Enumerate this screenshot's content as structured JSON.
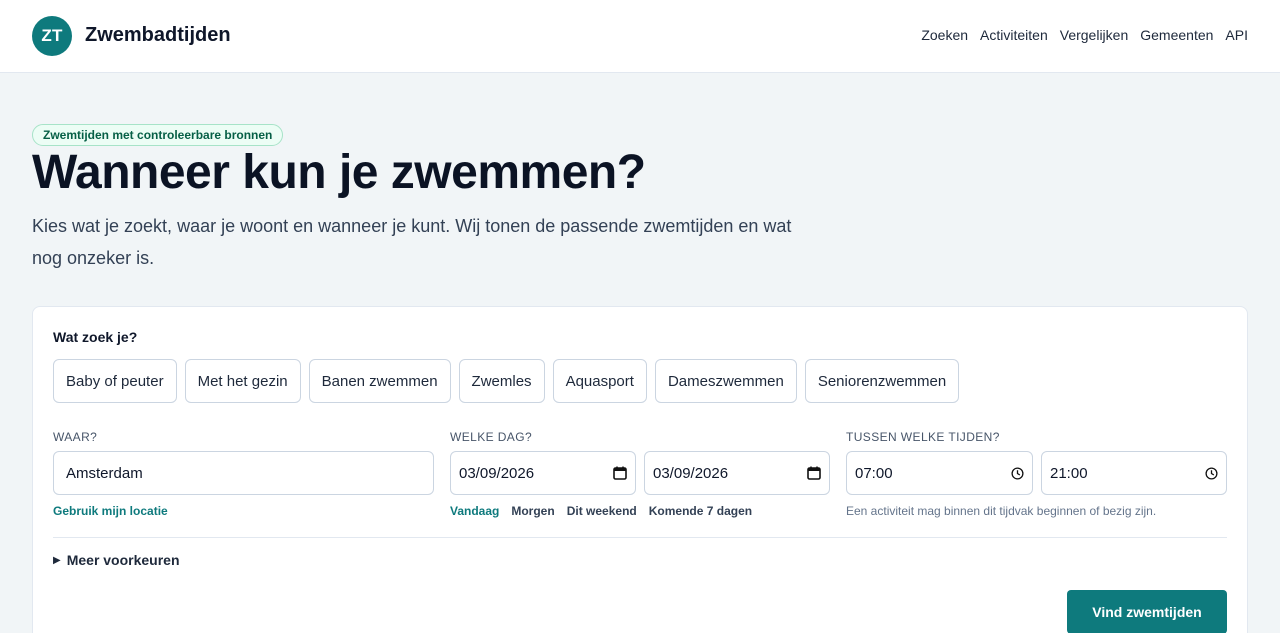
{
  "header": {
    "logo_text": "ZT",
    "brand": "Zwembadtijden",
    "nav": [
      "Zoeken",
      "Activiteiten",
      "Vergelijken",
      "Gemeenten",
      "API"
    ]
  },
  "hero": {
    "badge": "Zwemtijden met controleerbare bronnen",
    "title": "Wanneer kun je zwemmen?",
    "subtitle": "Kies wat je zoekt, waar je woont en wanneer je kunt. Wij tonen de passende zwemtijden en wat nog onzeker is."
  },
  "search": {
    "question": "Wat zoek je?",
    "activities": [
      "Baby of peuter",
      "Met het gezin",
      "Banen zwemmen",
      "Zwemles",
      "Aquasport",
      "Dameszwemmen",
      "Seniorenzwemmen"
    ],
    "where": {
      "label": "WAAR?",
      "value": "Amsterdam",
      "location_link": "Gebruik mijn locatie"
    },
    "day": {
      "label": "WELKE DAG?",
      "from": "03/09/2026",
      "to": "03/09/2026",
      "quick": [
        "Vandaag",
        "Morgen",
        "Dit weekend",
        "Komende 7 dagen"
      ],
      "active_quick": "Vandaag"
    },
    "time": {
      "label": "TUSSEN WELKE TIJDEN?",
      "from": "07:00",
      "to": "21:00",
      "hint": "Een activiteit mag binnen dit tijdvak beginnen of bezig zijn."
    },
    "more_prefs": "Meer voorkeuren",
    "submit": "Vind zwemtijden"
  },
  "colors": {
    "accent": "#0e7a7d",
    "badge_bg": "#ecfdf5",
    "badge_text": "#065f46",
    "page_bg": "#f1f5f7"
  }
}
